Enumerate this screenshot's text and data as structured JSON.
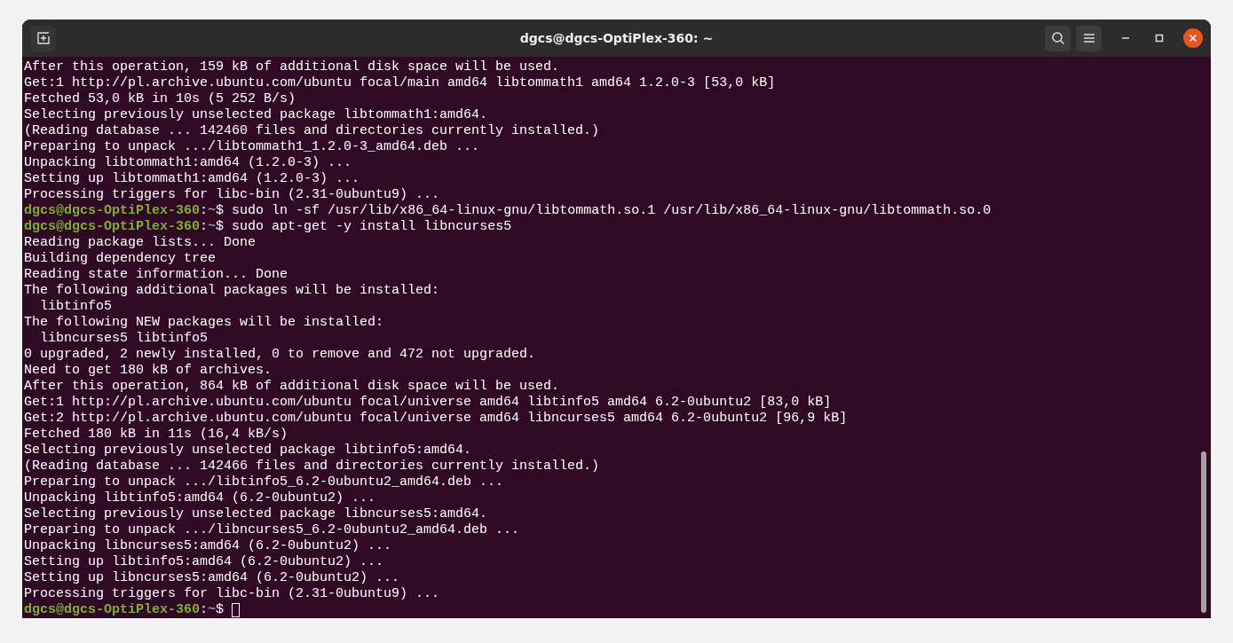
{
  "window": {
    "title": "dgcs@dgcs-OptiPlex-360: ~"
  },
  "terminal": {
    "lines": [
      {
        "kind": "output",
        "text": "After this operation, 159 kB of additional disk space will be used."
      },
      {
        "kind": "output",
        "text": "Get:1 http://pl.archive.ubuntu.com/ubuntu focal/main amd64 libtommath1 amd64 1.2.0-3 [53,0 kB]"
      },
      {
        "kind": "output",
        "text": "Fetched 53,0 kB in 10s (5 252 B/s)"
      },
      {
        "kind": "output",
        "text": "Selecting previously unselected package libtommath1:amd64."
      },
      {
        "kind": "output",
        "text": "(Reading database ... 142460 files and directories currently installed.)"
      },
      {
        "kind": "output",
        "text": "Preparing to unpack .../libtommath1_1.2.0-3_amd64.deb ..."
      },
      {
        "kind": "output",
        "text": "Unpacking libtommath1:amd64 (1.2.0-3) ..."
      },
      {
        "kind": "output",
        "text": "Setting up libtommath1:amd64 (1.2.0-3) ..."
      },
      {
        "kind": "output",
        "text": "Processing triggers for libc-bin (2.31-0ubuntu9) ..."
      },
      {
        "kind": "prompt",
        "user": "dgcs@dgcs-OptiPlex-360",
        "separator": ":",
        "path": "~",
        "symbol": "$",
        "command": "sudo ln -sf /usr/lib/x86_64-linux-gnu/libtommath.so.1 /usr/lib/x86_64-linux-gnu/libtommath.so.0",
        "cursor": false
      },
      {
        "kind": "prompt",
        "user": "dgcs@dgcs-OptiPlex-360",
        "separator": ":",
        "path": "~",
        "symbol": "$",
        "command": "sudo apt-get -y install libncurses5",
        "cursor": false
      },
      {
        "kind": "output",
        "text": "Reading package lists... Done"
      },
      {
        "kind": "output",
        "text": "Building dependency tree"
      },
      {
        "kind": "output",
        "text": "Reading state information... Done"
      },
      {
        "kind": "output",
        "text": "The following additional packages will be installed:"
      },
      {
        "kind": "output",
        "text": "  libtinfo5"
      },
      {
        "kind": "output",
        "text": "The following NEW packages will be installed:"
      },
      {
        "kind": "output",
        "text": "  libncurses5 libtinfo5"
      },
      {
        "kind": "output",
        "text": "0 upgraded, 2 newly installed, 0 to remove and 472 not upgraded."
      },
      {
        "kind": "output",
        "text": "Need to get 180 kB of archives."
      },
      {
        "kind": "output",
        "text": "After this operation, 864 kB of additional disk space will be used."
      },
      {
        "kind": "output",
        "text": "Get:1 http://pl.archive.ubuntu.com/ubuntu focal/universe amd64 libtinfo5 amd64 6.2-0ubuntu2 [83,0 kB]"
      },
      {
        "kind": "output",
        "text": "Get:2 http://pl.archive.ubuntu.com/ubuntu focal/universe amd64 libncurses5 amd64 6.2-0ubuntu2 [96,9 kB]"
      },
      {
        "kind": "output",
        "text": "Fetched 180 kB in 11s (16,4 kB/s)"
      },
      {
        "kind": "output",
        "text": "Selecting previously unselected package libtinfo5:amd64."
      },
      {
        "kind": "output",
        "text": "(Reading database ... 142466 files and directories currently installed.)"
      },
      {
        "kind": "output",
        "text": "Preparing to unpack .../libtinfo5_6.2-0ubuntu2_amd64.deb ..."
      },
      {
        "kind": "output",
        "text": "Unpacking libtinfo5:amd64 (6.2-0ubuntu2) ..."
      },
      {
        "kind": "output",
        "text": "Selecting previously unselected package libncurses5:amd64."
      },
      {
        "kind": "output",
        "text": "Preparing to unpack .../libncurses5_6.2-0ubuntu2_amd64.deb ..."
      },
      {
        "kind": "output",
        "text": "Unpacking libncurses5:amd64 (6.2-0ubuntu2) ..."
      },
      {
        "kind": "output",
        "text": "Setting up libtinfo5:amd64 (6.2-0ubuntu2) ..."
      },
      {
        "kind": "output",
        "text": "Setting up libncurses5:amd64 (6.2-0ubuntu2) ..."
      },
      {
        "kind": "output",
        "text": "Processing triggers for libc-bin (2.31-0ubuntu9) ..."
      },
      {
        "kind": "prompt",
        "user": "dgcs@dgcs-OptiPlex-360",
        "separator": ":",
        "path": "~",
        "symbol": "$",
        "cursor": true
      }
    ]
  }
}
